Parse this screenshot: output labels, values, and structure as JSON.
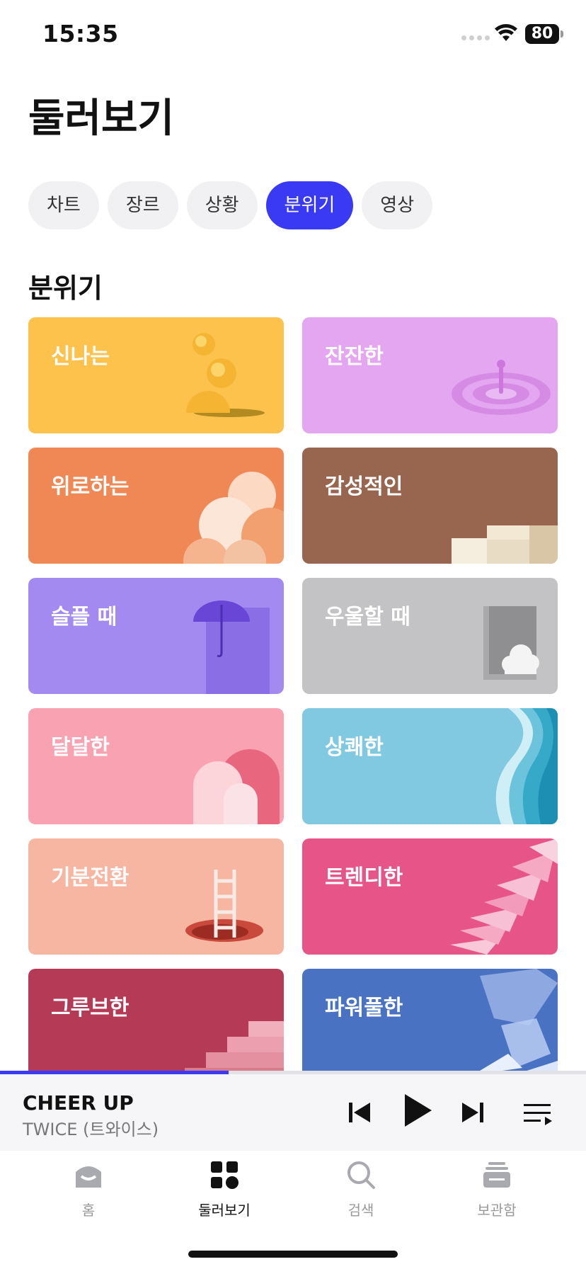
{
  "status_bar": {
    "time": "15:35",
    "battery": "80"
  },
  "page": {
    "title": "둘러보기"
  },
  "chips": [
    {
      "label": "차트",
      "active": false
    },
    {
      "label": "장르",
      "active": false
    },
    {
      "label": "상황",
      "active": false
    },
    {
      "label": "분위기",
      "active": true
    },
    {
      "label": "영상",
      "active": false
    }
  ],
  "section": {
    "title": "분위기"
  },
  "cards": [
    {
      "label": "신나는",
      "color": "#FDC24C",
      "art": "spheres-icon"
    },
    {
      "label": "잔잔한",
      "color": "#E4A6F0",
      "art": "water-drop-icon"
    },
    {
      "label": "위로하는",
      "color": "#F08856",
      "art": "bubbles-icon"
    },
    {
      "label": "감성적인",
      "color": "#98654F",
      "art": "steps-block-icon"
    },
    {
      "label": "슬플 때",
      "color": "#A38AF0",
      "art": "umbrella-icon"
    },
    {
      "label": "우울할 때",
      "color": "#C3C3C5",
      "art": "window-cloud-icon"
    },
    {
      "label": "달달한",
      "color": "#F9A2B1",
      "art": "arches-icon"
    },
    {
      "label": "상쾌한",
      "color": "#80C9E0",
      "art": "waves-icon"
    },
    {
      "label": "기분전환",
      "color": "#F7B6A2",
      "art": "ladder-icon"
    },
    {
      "label": "트렌디한",
      "color": "#E75487",
      "art": "cards-fan-icon"
    },
    {
      "label": "그루브한",
      "color": "#B43A55",
      "art": "stairs-icon"
    },
    {
      "label": "파워풀한",
      "color": "#4A72C3",
      "art": "glass-shards-icon"
    }
  ],
  "player": {
    "song": "CHEER UP",
    "artist": "TWICE (트와이스)",
    "progress": 0.39
  },
  "tabs": [
    {
      "label": "홈",
      "icon": "home-icon",
      "active": false
    },
    {
      "label": "둘러보기",
      "icon": "browse-grid-icon",
      "active": true
    },
    {
      "label": "검색",
      "icon": "search-icon",
      "active": false
    },
    {
      "label": "보관함",
      "icon": "library-icon",
      "active": false
    }
  ],
  "colors": {
    "accent": "#3A3AF4"
  }
}
